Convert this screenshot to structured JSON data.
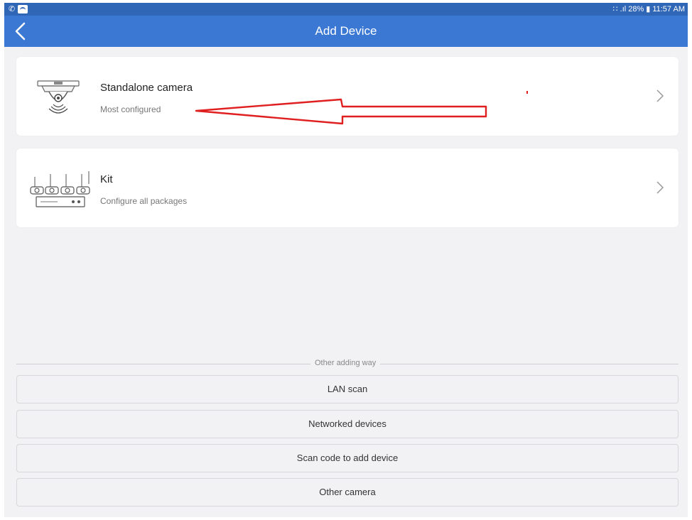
{
  "status_bar": {
    "time": "11:57 AM",
    "battery": "28%",
    "left_icons": [
      "phone-icon",
      "wifi-calling-icon"
    ],
    "right_icons": [
      "network-icon",
      "signal-icon",
      "battery-icon"
    ]
  },
  "header": {
    "title": "Add Device",
    "back_icon": "back-arrow-icon"
  },
  "cards": [
    {
      "title": "Standalone camera",
      "subtitle": "Most configured",
      "icon": "standalone-camera-icon"
    },
    {
      "title": "Kit",
      "subtitle": "Configure all packages",
      "icon": "camera-kit-icon"
    }
  ],
  "annotation": {
    "color": "#e02020"
  },
  "other": {
    "label": "Other adding way",
    "options": [
      "LAN scan",
      "Networked devices",
      "Scan code to add device",
      "Other camera"
    ]
  },
  "colors": {
    "title_bar": "#3a78d3",
    "status_bar": "#2f66b6",
    "background": "#f2f2f4"
  }
}
